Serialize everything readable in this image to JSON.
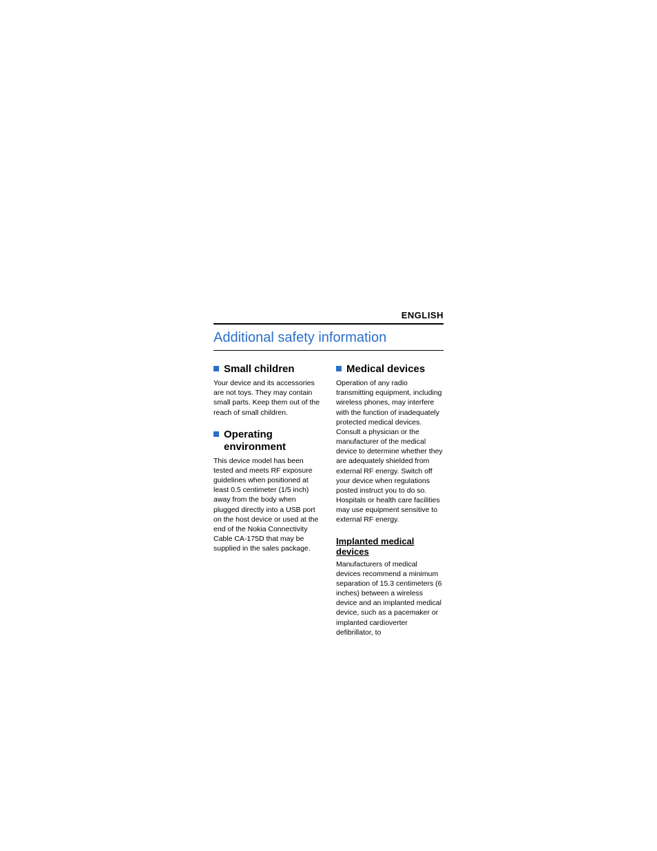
{
  "language_label": "ENGLISH",
  "title": "Additional safety information",
  "left": {
    "small_children": {
      "heading": "Small children",
      "body": "Your device and its accessories are not toys. They may contain small parts. Keep them out of the reach of small children."
    },
    "operating_environment": {
      "heading": "Operating environment",
      "body": "This device model has been tested and meets RF exposure guidelines when positioned at least 0.5 centimeter (1/5 inch) away from the body when plugged directly into a USB port on the host device or used at the end of the Nokia Connectivity Cable CA-175D that may be supplied in the sales package."
    }
  },
  "right": {
    "medical_devices": {
      "heading": "Medical devices",
      "body": "Operation of any radio transmitting equipment, including wireless phones, may interfere with the function of inadequately protected medical devices. Consult a physician or the manufacturer of the medical device to determine whether they are adequately shielded from external RF energy. Switch off your device when regulations posted instruct you to do so. Hospitals or health care facilities may use equipment sensitive to external RF energy."
    },
    "implanted": {
      "heading": "Implanted medical devices",
      "body": "Manufacturers of medical devices recommend a minimum separation of 15.3 centimeters (6 inches) between a wireless device and an implanted medical device, such as a pacemaker or implanted cardioverter defibrillator, to"
    }
  }
}
